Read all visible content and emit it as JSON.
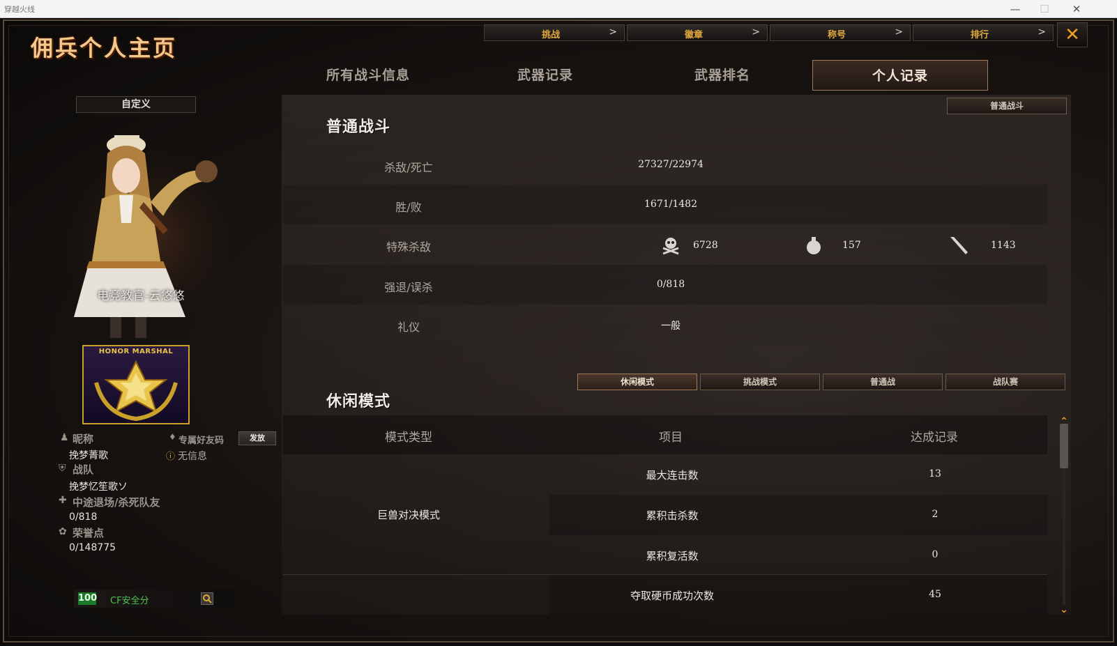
{
  "window": {
    "title": "穿越火线",
    "min": "—",
    "max": "☐",
    "close": "✕"
  },
  "page_title": "佣兵个人主页",
  "topnav": [
    {
      "label": "挑战",
      "arrow": ">"
    },
    {
      "label": "徽章",
      "arrow": ">"
    },
    {
      "label": "称号",
      "arrow": ">"
    },
    {
      "label": "排行",
      "arrow": ">"
    }
  ],
  "close_label": "✕",
  "tabs": [
    "所有战斗信息",
    "武器记录",
    "武器排名",
    "个人记录"
  ],
  "active_tab": "个人记录",
  "profile": {
    "custom_button": "自定义",
    "character_name": "电竞教官-云悠悠",
    "rank_badge_text": "HONOR MARSHAL",
    "nickname_label": "昵称",
    "nickname": "挽梦菁歌",
    "friend_code_label": "专属好友码",
    "send_button": "发放",
    "friend_code_value": "无信息",
    "team_label": "战队",
    "team": "挽梦忆笙歌ソ",
    "quit_label": "中途退场/杀死队友",
    "quit_value": "0/818",
    "honor_label": "荣誉点",
    "honor_value": "0/148775",
    "safety_score": "100",
    "safety_label": "CF安全分"
  },
  "normal_battle": {
    "section_title": "普通战斗",
    "filter_button": "普通战斗",
    "rows": [
      {
        "label": "杀敌/死亡",
        "value": "27327/22974"
      },
      {
        "label": "胜/败",
        "value": "1671/1482"
      },
      {
        "label": "特殊杀敌",
        "value": ""
      },
      {
        "label": "强退/误杀",
        "value": "0/818"
      },
      {
        "label": "礼仪",
        "value": "一般"
      }
    ],
    "special_kills": [
      {
        "icon": "skull-icon",
        "value": "6728"
      },
      {
        "icon": "grenade-icon",
        "value": "157"
      },
      {
        "icon": "knife-icon",
        "value": "1143"
      }
    ]
  },
  "casual": {
    "section_title": "休闲模式",
    "mode_tabs": [
      "休闲模式",
      "挑战模式",
      "普通战",
      "战队赛"
    ],
    "active_mode_tab": "休闲模式",
    "columns": [
      "模式类型",
      "项目",
      "达成记录"
    ],
    "mode_type": "巨兽对决模式",
    "rows": [
      {
        "item": "最大连击数",
        "record": "13"
      },
      {
        "item": "累积击杀数",
        "record": "2"
      },
      {
        "item": "累积复活数",
        "record": "0"
      },
      {
        "item": "夺取硬币成功次数",
        "record": "45"
      }
    ]
  },
  "colors": {
    "accent": "#e2a93e",
    "gold": "#f3c88c",
    "active_border": "#a07a5a",
    "safety_green": "#4ec24e"
  }
}
